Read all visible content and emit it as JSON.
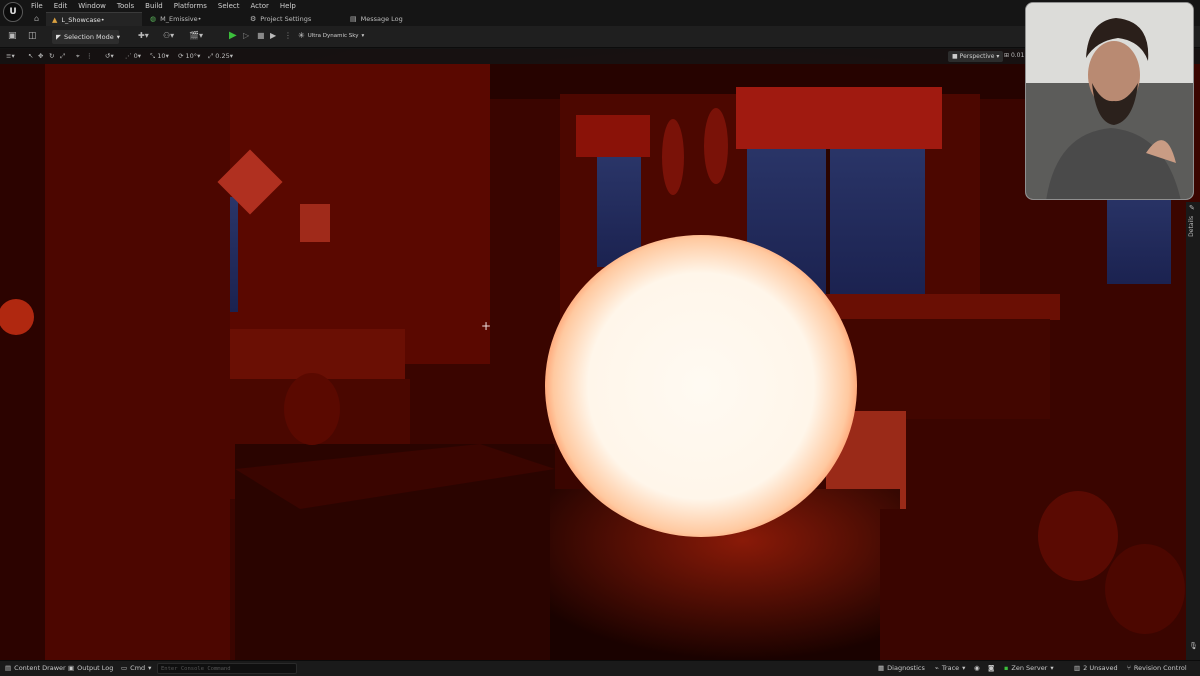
{
  "menu": {
    "items": [
      "File",
      "Edit",
      "Window",
      "Tools",
      "Build",
      "Platforms",
      "Select",
      "Actor",
      "Help"
    ]
  },
  "tabs": [
    {
      "label": "L_Showcase•",
      "icon": "level-icon"
    },
    {
      "label": "M_Emissive•",
      "icon": "material-icon"
    },
    {
      "label": "Project Settings",
      "icon": "settings-icon"
    },
    {
      "label": "Message Log",
      "icon": "log-icon"
    }
  ],
  "toolbar": {
    "mode_label": "Selection Mode",
    "sky_label": "Ultra Dynamic Sky"
  },
  "viewport": {
    "snap_translate": "10",
    "snap_rotate": "10°",
    "snap_scale": "0.25",
    "perspective_label": "Perspective",
    "extra_value": "0.01"
  },
  "details": {
    "label": "Details"
  },
  "status": {
    "content_drawer": "Content Drawer",
    "output_log": "Output Log",
    "cmd": "Cmd",
    "console_placeholder": "Enter Console Command",
    "diagnostics": "Diagnostics",
    "trace": "Trace",
    "zen_server": "Zen Server",
    "unsaved": "2 Unsaved",
    "revision": "Revision Control"
  },
  "colors": {
    "accent_play": "#3cc03c",
    "viewport_tint": "#6a0a00",
    "orb": "#fff6ea"
  }
}
